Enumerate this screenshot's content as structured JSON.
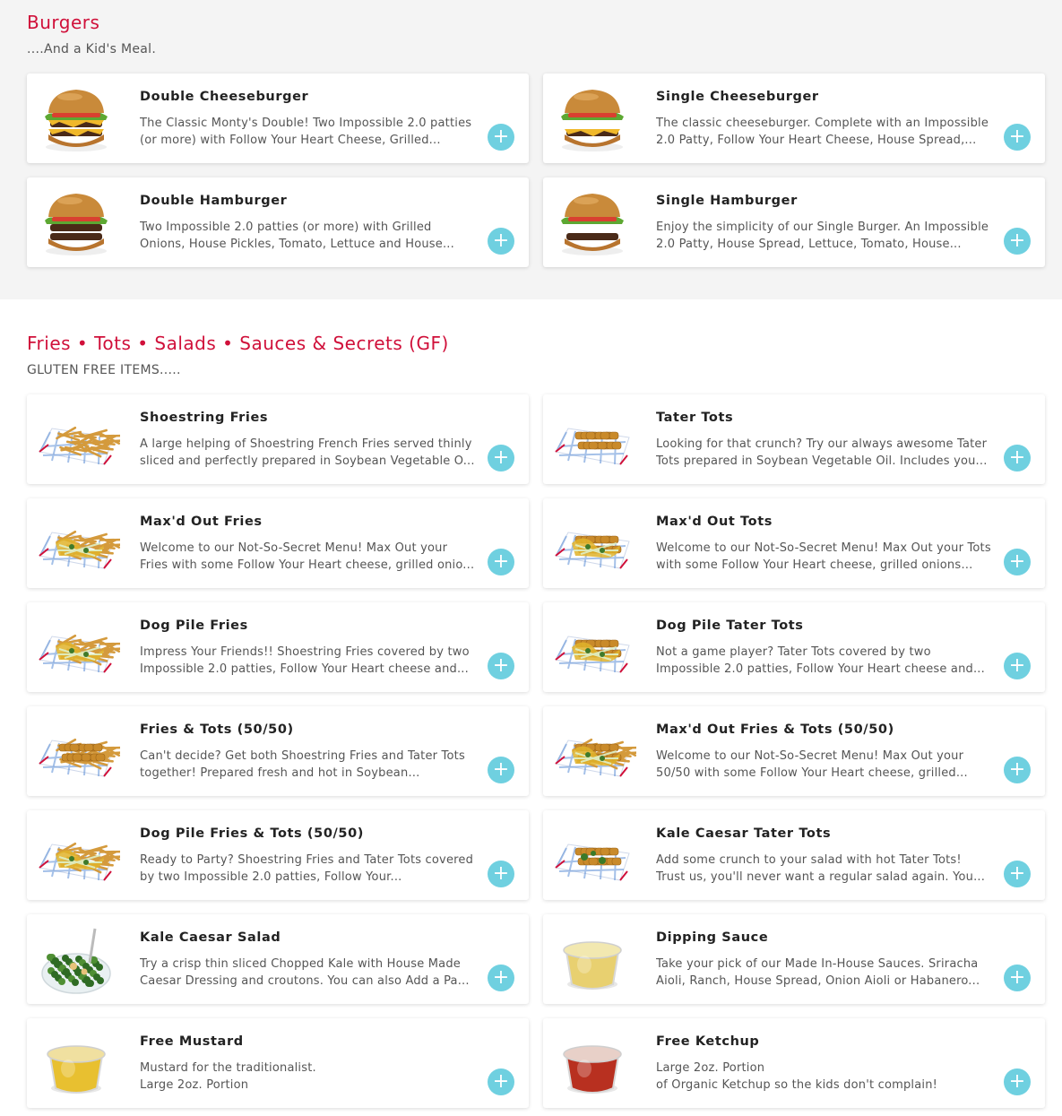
{
  "colors": {
    "accent": "#d0103a",
    "add_button": "#6fd0e0"
  },
  "sections": [
    {
      "title": "Burgers",
      "subtitle": "....And a Kid's Meal.",
      "items": [
        {
          "name": "Double Cheeseburger",
          "desc": "The Classic Monty's Double! Two Impossible 2.0 patties (or more) with Follow Your Heart Cheese, Grilled...",
          "img": "double-cheeseburger",
          "add": "+"
        },
        {
          "name": "Single Cheeseburger",
          "desc": "The classic cheeseburger. Complete with an Impossible 2.0 Patty, Follow Your Heart Cheese, House Spread,...",
          "img": "cheeseburger",
          "add": "+"
        },
        {
          "name": "Double Hamburger",
          "desc": "Two Impossible 2.0 patties (or more) with Grilled Onions, House Pickles, Tomato, Lettuce and House...",
          "img": "double-burger",
          "add": "+"
        },
        {
          "name": "Single Hamburger",
          "desc": "Enjoy the simplicity of our Single Burger. An Impossible 2.0 Patty, House Spread, Lettuce, Tomato, House...",
          "img": "burger",
          "add": "+"
        }
      ]
    },
    {
      "title": "Fries • Tots • Salads • Sauces & Secrets (GF)",
      "subtitle": "GLUTEN FREE ITEMS.....",
      "items": [
        {
          "name": "Shoestring Fries",
          "desc": "A large helping of Shoestring French Fries served thinly sliced and perfectly prepared in Soybean Vegetable O...",
          "img": "fries",
          "add": "+"
        },
        {
          "name": "Tater Tots",
          "desc": "Looking for that crunch? Try our always awesome Tater Tots prepared in Soybean Vegetable Oil. Includes you...",
          "img": "tots",
          "add": "+"
        },
        {
          "name": "Max'd Out Fries",
          "desc": "Welcome to our Not-So-Secret Menu! Max Out your Fries with some Follow Your Heart cheese, grilled onio...",
          "img": "loaded-fries",
          "add": "+"
        },
        {
          "name": "Max'd Out Tots",
          "desc": "Welcome to our Not-So-Secret Menu! Max Out your Tots with some Follow Your Heart cheese, grilled onions an...",
          "img": "loaded-tots",
          "add": "+"
        },
        {
          "name": "Dog Pile Fries",
          "desc": "Impress Your Friends!! Shoestring Fries covered by two Impossible 2.0 patties, Follow Your Heart cheese and...",
          "img": "dogpile-fries",
          "add": "+"
        },
        {
          "name": "Dog Pile Tater Tots",
          "desc": "Not a game player? Tater Tots covered by two Impossible 2.0 patties, Follow Your Heart cheese and...",
          "img": "dogpile-tots",
          "add": "+"
        },
        {
          "name": "Fries & Tots (50/50)",
          "desc": "Can't decide? Get both Shoestring Fries and Tater Tots together! Prepared fresh and hot in Soybean Vegetabl...",
          "img": "fries-tots",
          "add": "+"
        },
        {
          "name": "Max'd Out Fries & Tots (50/50)",
          "desc": "Welcome to our Not-So-Secret Menu! Max Out your 50/50 with some Follow Your Heart cheese, grilled...",
          "img": "loaded-fries-tots",
          "add": "+"
        },
        {
          "name": "Dog Pile Fries & Tots (50/50)",
          "desc": "Ready to Party? Shoestring Fries and Tater Tots covered by two Impossible 2.0 patties, Follow Your...",
          "img": "dogpile-fries-tots",
          "add": "+"
        },
        {
          "name": "Kale Caesar Tater Tots",
          "desc": "Add some crunch to your salad with hot Tater Tots! Trust us, you'll never want a regular salad again. You...",
          "img": "kale-tots",
          "add": "+"
        },
        {
          "name": "Kale Caesar Salad",
          "desc": "Try a crisp thin sliced Chopped Kale with House Made Caesar Dressing and croutons. You can also Add a Pa...",
          "img": "salad",
          "add": "+"
        },
        {
          "name": "Dipping Sauce",
          "desc": "Take your pick of our Made In-House Sauces. Sriracha Aioli, Ranch, House Spread, Onion Aioli or Habanero...",
          "img": "sauce-cup",
          "add": "+"
        },
        {
          "name": "Free Mustard",
          "desc": "Mustard for the traditionalist.\nLarge 2oz. Portion",
          "img": "mustard-cup",
          "add": "+"
        },
        {
          "name": "Free Ketchup",
          "desc": "Large 2oz. Portion\nof Organic Ketchup so the kids don't complain!",
          "img": "ketchup-cup",
          "add": "+"
        }
      ]
    }
  ]
}
